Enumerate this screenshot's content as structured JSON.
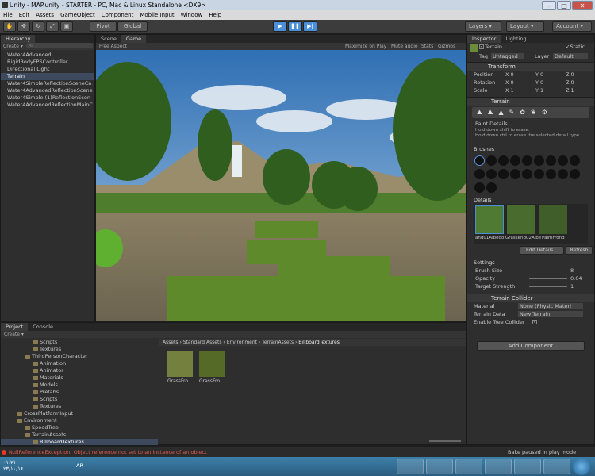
{
  "window": {
    "title": "Unity - MAP.unity - STARTER - PC, Mac & Linux Standalone <DX9>"
  },
  "menu": [
    "File",
    "Edit",
    "Assets",
    "GameObject",
    "Component",
    "Mobile Input",
    "Window",
    "Help"
  ],
  "toolbar": {
    "pivot": "Pivot",
    "global": "Global",
    "layers": "Layers",
    "layout": "Layout",
    "account": "Account"
  },
  "hierarchy": {
    "tab": "Hierarchy",
    "create": "Create",
    "search_placeholder": "All",
    "items": [
      "Water4Advanced",
      "RigidBodyFPSController",
      "Directional Light",
      "Terrain",
      "Water4SimpleReflectionSceneCa",
      "Water4AdvancedReflectionScene",
      "Water4Simple (1)ReflectionScen",
      "Water4AdvancedReflectionMainC"
    ]
  },
  "viewtabs": {
    "scene": "Scene",
    "game": "Game",
    "aspect": "Free Aspect",
    "maximize": "Maximize on Play",
    "mute": "Mute audio",
    "stats": "Stats",
    "gizmos": "Gizmos"
  },
  "inspector": {
    "tab": "Inspector",
    "lighting": "Lighting",
    "object_name": "Terrain",
    "static": "Static",
    "tag_label": "Tag",
    "tag_value": "Untagged",
    "layer_label": "Layer",
    "layer_value": "Default",
    "transform": {
      "title": "Transform",
      "rows": [
        {
          "label": "Position",
          "x": "0",
          "y": "0",
          "z": "0"
        },
        {
          "label": "Rotation",
          "x": "0",
          "y": "0",
          "z": "0"
        },
        {
          "label": "Scale",
          "x": "1",
          "y": "1",
          "z": "1"
        }
      ]
    },
    "terrain": {
      "title": "Terrain",
      "section": "Paint Details",
      "hint1": "Hold down shift to erase.",
      "hint2": "Hold down ctrl to erase the selected detail type.",
      "brushes": "Brushes",
      "details": "Details",
      "detail_items": [
        "and01Albedo",
        "Grassend02Albe",
        "PalmFrond"
      ],
      "edit_details": "Edit Details...",
      "refresh": "Refresh",
      "settings": "Settings",
      "brush_size_label": "Brush Size",
      "brush_size": "8",
      "opacity_label": "Opacity",
      "opacity": "0.04",
      "target_strength_label": "Target Strength",
      "target_strength": "1"
    },
    "collider": {
      "title": "Terrain Collider",
      "material_label": "Material",
      "material_value": "None (Physic Materi",
      "data_label": "Terrain Data",
      "data_value": "New Terrain",
      "enable_trees": "Enable Tree Collider"
    },
    "add_component": "Add Component"
  },
  "project": {
    "tab": "Project",
    "console": "Console",
    "create": "Create",
    "tree": [
      {
        "label": "Scripts",
        "indent": 3
      },
      {
        "label": "Textures",
        "indent": 3
      },
      {
        "label": "ThirdPersonCharacter",
        "indent": 2
      },
      {
        "label": "Animation",
        "indent": 3
      },
      {
        "label": "Animator",
        "indent": 3
      },
      {
        "label": "Materials",
        "indent": 3
      },
      {
        "label": "Models",
        "indent": 3
      },
      {
        "label": "Prefabs",
        "indent": 3
      },
      {
        "label": "Scripts",
        "indent": 3
      },
      {
        "label": "Textures",
        "indent": 3
      },
      {
        "label": "CrossPlatformInput",
        "indent": 1
      },
      {
        "label": "Environment",
        "indent": 1
      },
      {
        "label": "SpeedTree",
        "indent": 2
      },
      {
        "label": "TerrainAssets",
        "indent": 2
      },
      {
        "label": "BillboardTextures",
        "indent": 3
      }
    ],
    "breadcrumb": [
      "Assets",
      "Standard Assets",
      "Environment",
      "TerrainAssets",
      "BillboardTextures"
    ],
    "assets": [
      "GrassFro...",
      "GrassFro..."
    ]
  },
  "status": {
    "error": "NullReferenceException: Object reference not set to an instance of an object",
    "bake": "Bake paused in play mode"
  },
  "taskbar": {
    "time": "۰۱:۲۱",
    "date": "۲۳/۱۰/۱۶",
    "lang": "AR"
  }
}
